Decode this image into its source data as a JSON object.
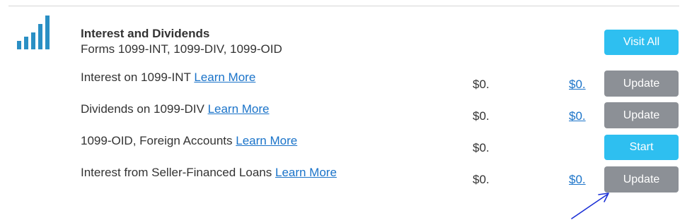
{
  "section": {
    "title": "Interest and Dividends",
    "subtitle": "Forms 1099-INT, 1099-DIV, 1099-OID",
    "icon": "bar-chart-icon",
    "visit_all_label": "Visit All"
  },
  "rows": [
    {
      "label": "Interest on 1099-INT",
      "learn_more": "Learn More",
      "amount": "$0.",
      "amount_link": "$0.",
      "button": "Update"
    },
    {
      "label": "Dividends on 1099-DIV",
      "learn_more": "Learn More",
      "amount": "$0.",
      "amount_link": "$0.",
      "button": "Update"
    },
    {
      "label": "1099-OID, Foreign Accounts",
      "learn_more": "Learn More",
      "amount": "$0.",
      "button": "Start"
    },
    {
      "label": "Interest from Seller-Financed Loans",
      "learn_more": "Learn More",
      "amount": "$0.",
      "amount_link": "$0.",
      "button": "Update"
    }
  ],
  "colors": {
    "accent_blue": "#2ebff0",
    "button_gray": "#8c9096",
    "link_blue": "#1a73c9",
    "icon_blue": "#2a8fc4",
    "annotation": "#1a2fd6"
  }
}
